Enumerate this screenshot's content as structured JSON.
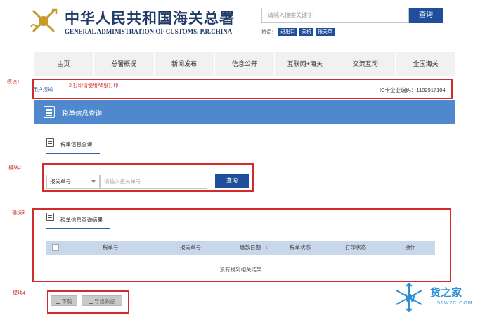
{
  "header": {
    "title_cn": "中华人民共和国海关总署",
    "title_en": "GENERAL ADMINISTRATION OF CUSTOMS, P.R.CHINA",
    "search_placeholder": "请输入搜索关键字",
    "search_button": "查询",
    "hot_label": "热词：",
    "hot_tags": [
      "进出口",
      "关税",
      "报关单"
    ]
  },
  "nav": [
    "主页",
    "总署概况",
    "新闻发布",
    "信息公开",
    "互联网+海关",
    "交流互动",
    "全国海关"
  ],
  "annotations": {
    "module1": "模块1",
    "module2": "模块2",
    "module3": "模块3",
    "module4": "模块4"
  },
  "module1": {
    "notice_link": "用户须知",
    "print_tip": "2.打印请使用A5纸打印",
    "ic_label": "IC卡企业编码：1102917104"
  },
  "page": {
    "title": "税单信息查询",
    "query_tab": "税单信息查询",
    "result_tab": "税单信息查询结果"
  },
  "form": {
    "select_value": "报关单号",
    "input_placeholder": "请输入报关单号",
    "query_button": "查询"
  },
  "table": {
    "columns": [
      "税单号",
      "报关单号",
      "缴款日期",
      "税单状态",
      "打印状态",
      "操作"
    ],
    "sort_indicator": "⇕",
    "empty_text": "没有找到相关结果"
  },
  "actions": {
    "download": "下载",
    "export": "导出数据"
  },
  "watermark": {
    "text": "货之家",
    "url": "51W2C.COM"
  },
  "colors": {
    "primary": "#1f4f9a",
    "banner": "#4f88cc",
    "annotation_red": "#d32b2b",
    "table_header": "#c8d8ea"
  }
}
